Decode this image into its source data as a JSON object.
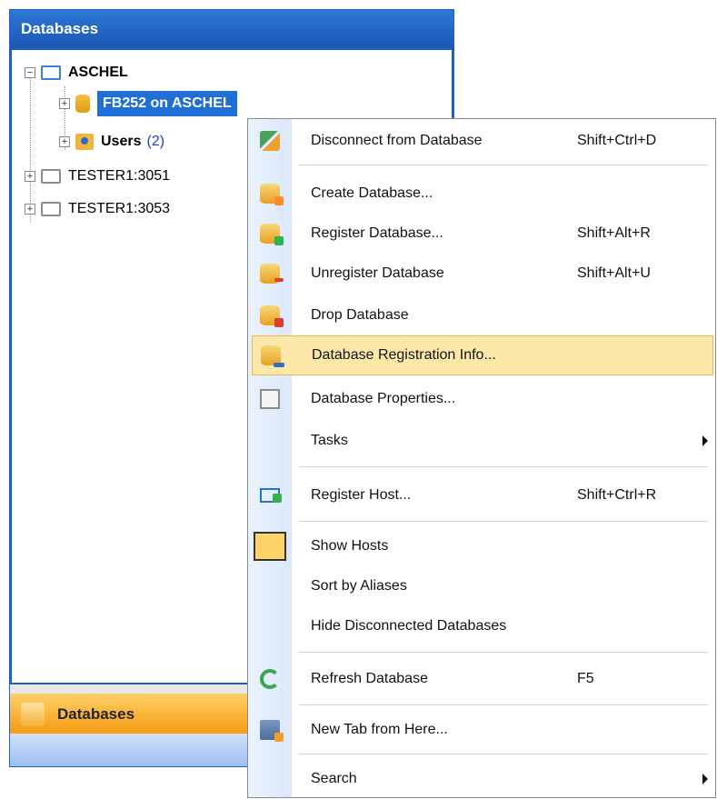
{
  "panel": {
    "title": "Databases",
    "tree": [
      {
        "label": "ASCHEL"
      },
      {
        "label": "FB252 on ASCHEL"
      },
      {
        "label": "Users",
        "count": "(2)"
      },
      {
        "label": "TESTER1:3051"
      },
      {
        "label": "TESTER1:3053"
      }
    ],
    "nav_tab": "Databases"
  },
  "menu": {
    "items": [
      {
        "label": "Disconnect from Database",
        "shortcut": "Shift+Ctrl+D",
        "icon": "disconnect-icon"
      },
      {
        "label": "Create Database...",
        "shortcut": "",
        "icon": "create-database-icon"
      },
      {
        "label": "Register Database...",
        "shortcut": "Shift+Alt+R",
        "icon": "register-database-icon"
      },
      {
        "label": "Unregister Database",
        "shortcut": "Shift+Alt+U",
        "icon": "unregister-database-icon"
      },
      {
        "label": "Drop Database",
        "shortcut": "",
        "icon": "drop-database-icon"
      },
      {
        "label": "Database Registration Info...",
        "shortcut": "",
        "icon": "registration-info-icon"
      },
      {
        "label": "Database Properties...",
        "shortcut": "",
        "icon": "properties-icon"
      },
      {
        "label": "Tasks",
        "shortcut": "",
        "icon": ""
      },
      {
        "label": "Register Host...",
        "shortcut": "Shift+Ctrl+R",
        "icon": "register-host-icon"
      },
      {
        "label": "Show Hosts",
        "shortcut": "",
        "icon": "show-hosts-icon"
      },
      {
        "label": "Sort by Aliases",
        "shortcut": "",
        "icon": ""
      },
      {
        "label": "Hide Disconnected Databases",
        "shortcut": "",
        "icon": ""
      },
      {
        "label": "Refresh Database",
        "shortcut": "F5",
        "icon": "refresh-icon"
      },
      {
        "label": "New Tab from Here...",
        "shortcut": "",
        "icon": "new-tab-icon"
      },
      {
        "label": "Search",
        "shortcut": "",
        "icon": ""
      }
    ]
  },
  "colors": {
    "selection": "#1f6fd6",
    "highlight": "#fde8aa",
    "header": "#1b57b3",
    "nav_tab": "#f49a0f"
  }
}
